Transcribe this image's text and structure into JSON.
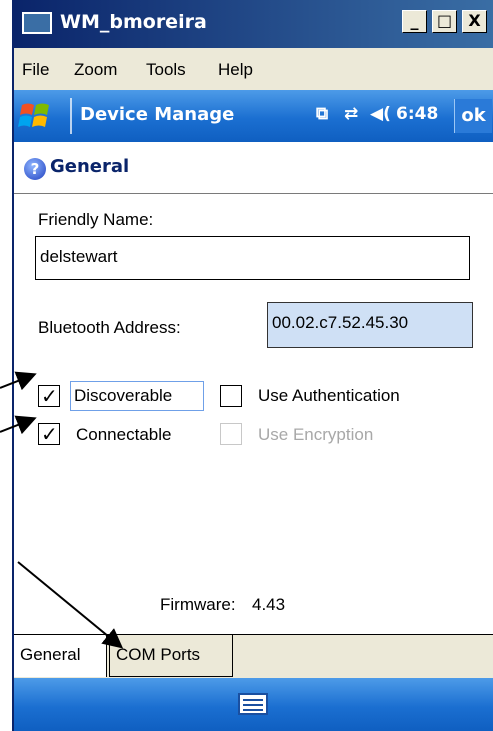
{
  "window": {
    "title": "WM_bmoreira",
    "minimize_glyph": "_",
    "maximize_glyph": "□",
    "close_glyph": "X"
  },
  "menubar": {
    "items": [
      "File",
      "Zoom",
      "Tools",
      "Help"
    ]
  },
  "navbar": {
    "title": "Device Manage",
    "status_icon_1": "⧉",
    "status_icon_2": "⇄",
    "volume_icon": "◀(",
    "time": "6:48",
    "ok_label": "ok"
  },
  "section": {
    "title": "General"
  },
  "form": {
    "friendly_name_label": "Friendly Name:",
    "friendly_name_value": "delstewart",
    "bt_address_label": "Bluetooth Address:",
    "bt_address_value": "00.02.c7.52.45.30",
    "discoverable_label": "Discoverable",
    "discoverable_checked": true,
    "use_auth_label": "Use Authentication",
    "use_auth_checked": false,
    "connectable_label": "Connectable",
    "connectable_checked": true,
    "use_encryption_label": "Use Encryption",
    "use_encryption_checked": false,
    "use_encryption_enabled": false,
    "firmware_label": "Firmware:",
    "firmware_value": "4.43",
    "check_glyph": "✓"
  },
  "tabs": {
    "items": [
      "General",
      "COM Ports"
    ],
    "active": "General"
  },
  "colors": {
    "title_bar": "#0a246a",
    "nav_bar": "#1b6fd1",
    "readonly_field": "#cfe0f5"
  }
}
